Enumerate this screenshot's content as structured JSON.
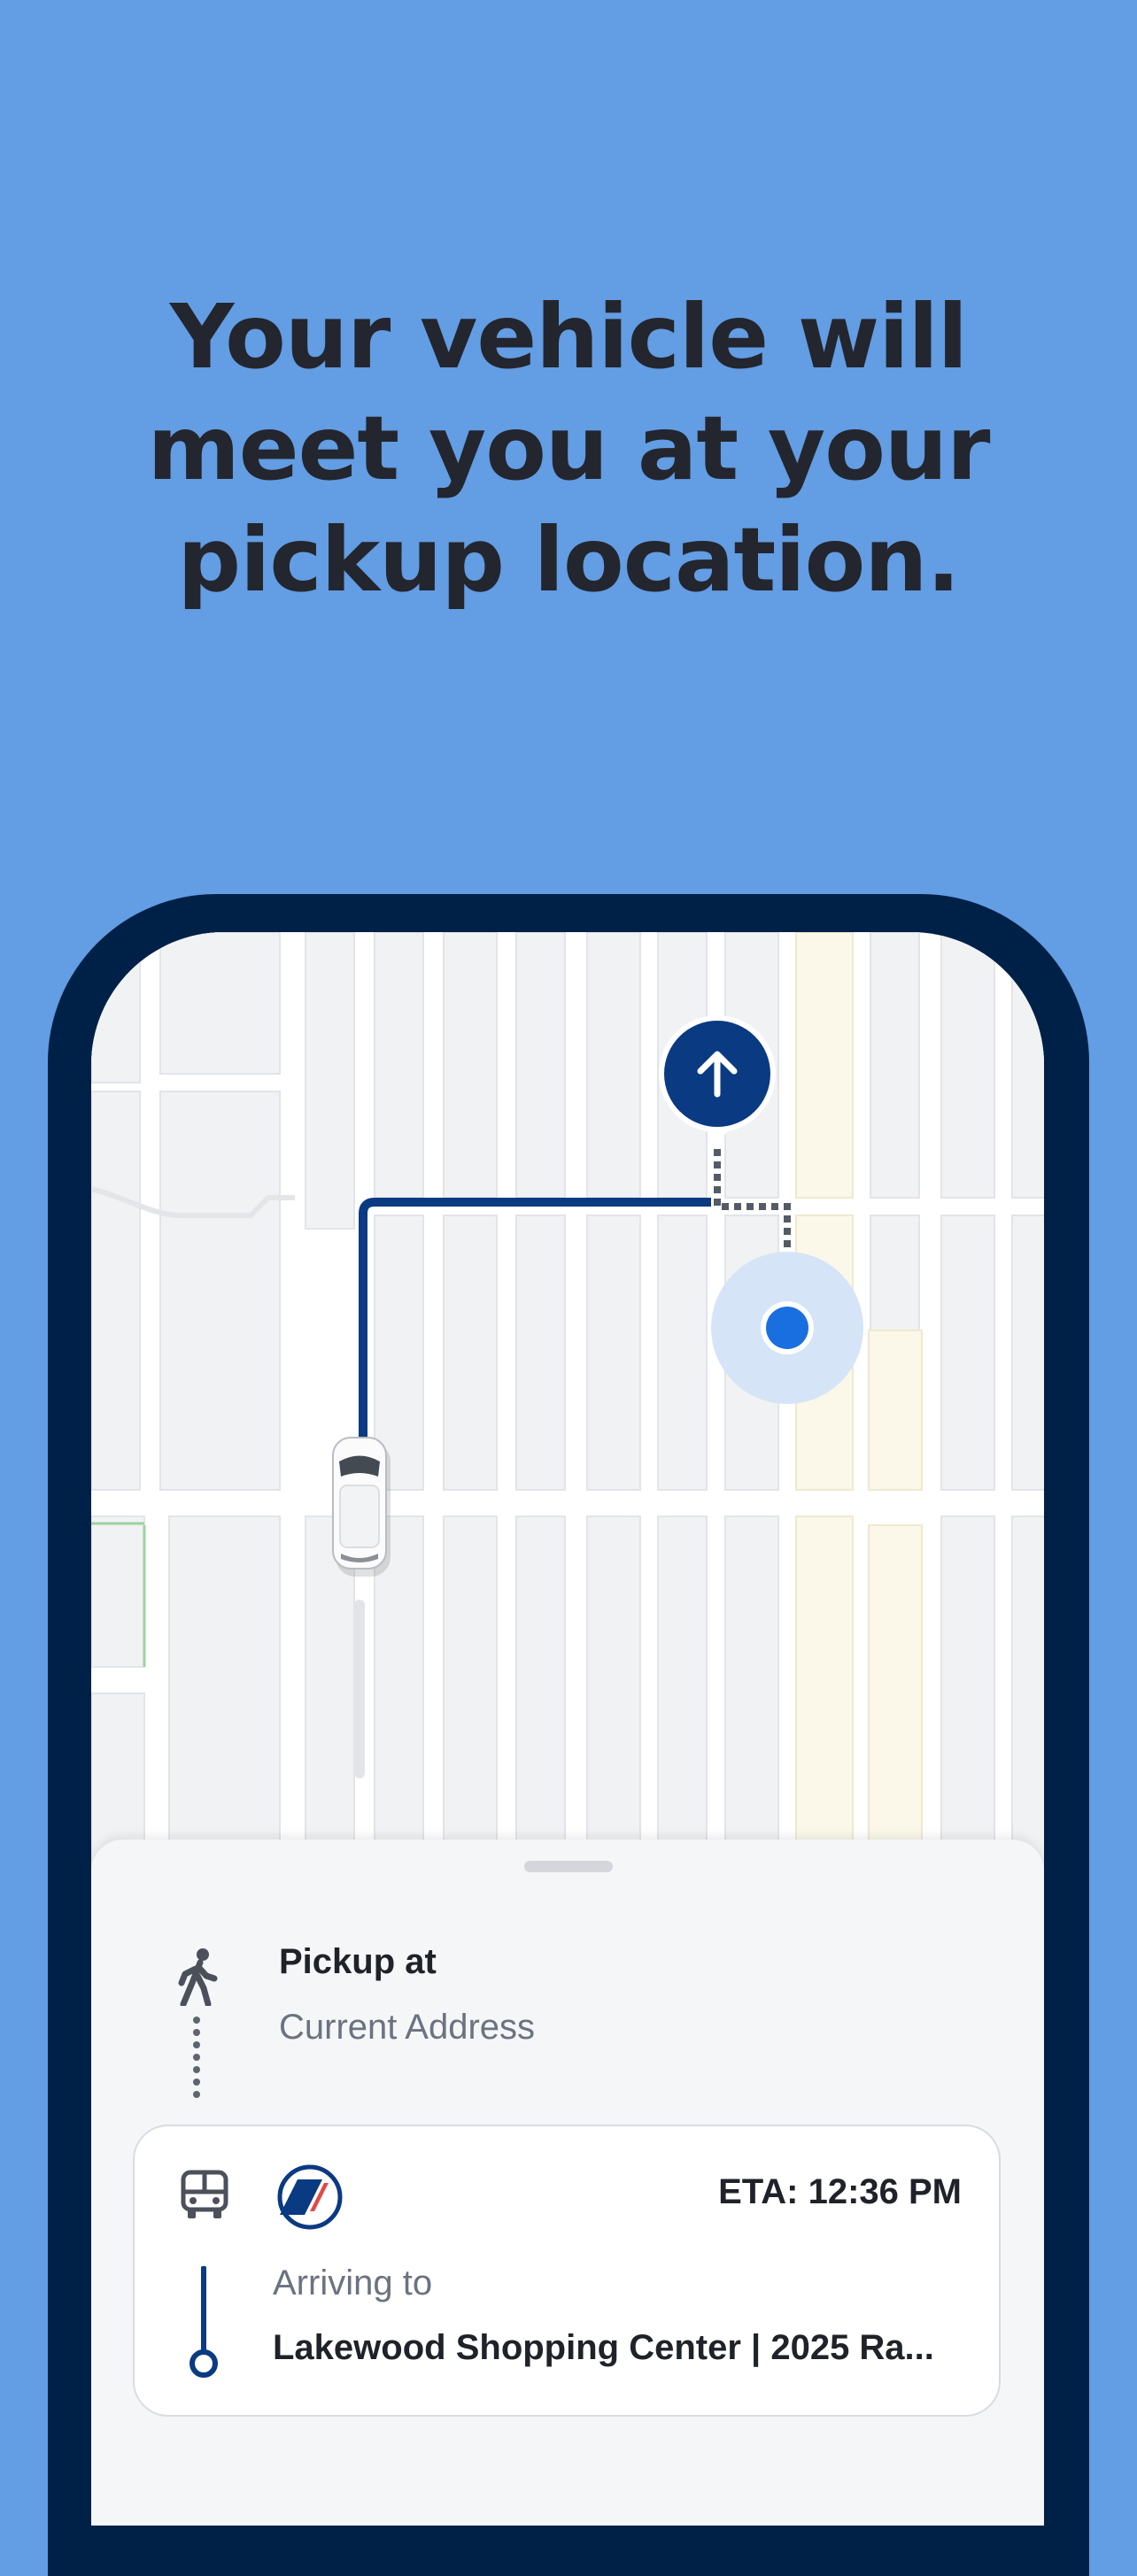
{
  "headline": {
    "line1": "Your vehicle will",
    "line2": "meet you at your",
    "line3": "pickup location."
  },
  "colors": {
    "background": "#639de3",
    "phone_frame": "#002147",
    "route": "#0a3a82",
    "user_dot": "#1a6fe0",
    "marker": "#0a3a82"
  },
  "map": {
    "destination_marker_icon": "arrow-up-icon",
    "vehicle_icon": "car-icon",
    "user_location_icon": "location-dot-icon"
  },
  "pickup": {
    "icon": "walking-person-icon",
    "title": "Pickup at",
    "address": "Current Address"
  },
  "trip": {
    "vehicle_icon": "bus-icon",
    "brand_icon": "brand-logo-icon",
    "eta": "ETA: 12:36 PM",
    "arriving_label": "Arriving to",
    "destination": "Lakewood Shopping Center | 2025 Ra..."
  }
}
